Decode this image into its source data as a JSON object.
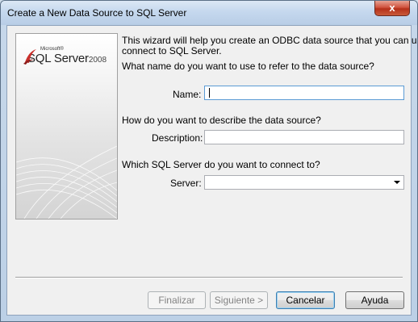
{
  "window": {
    "title": "Create a New Data Source to SQL Server",
    "close_label": "x"
  },
  "banner": {
    "brand": "Microsoft®",
    "product": "SQL Server",
    "version": "2008"
  },
  "content": {
    "intro": [
      "This wizard will help you create an ODBC data source that you can use to",
      "connect to SQL Server."
    ],
    "name_question": "What name do you want to use to refer to the data source?",
    "name_label": "Name:",
    "name_value": "",
    "description_question": "How do you want to describe the data source?",
    "description_label": "Description:",
    "description_value": "",
    "server_question": "Which SQL Server do you want to connect to?",
    "server_label": "Server:",
    "server_value": ""
  },
  "buttons": {
    "finish": "Finalizar",
    "next": "Siguiente >",
    "cancel": "Cancelar",
    "help": "Ayuda"
  },
  "colors": {
    "accent_focus": "#5b9bd5",
    "close_button": "#c8412a"
  }
}
